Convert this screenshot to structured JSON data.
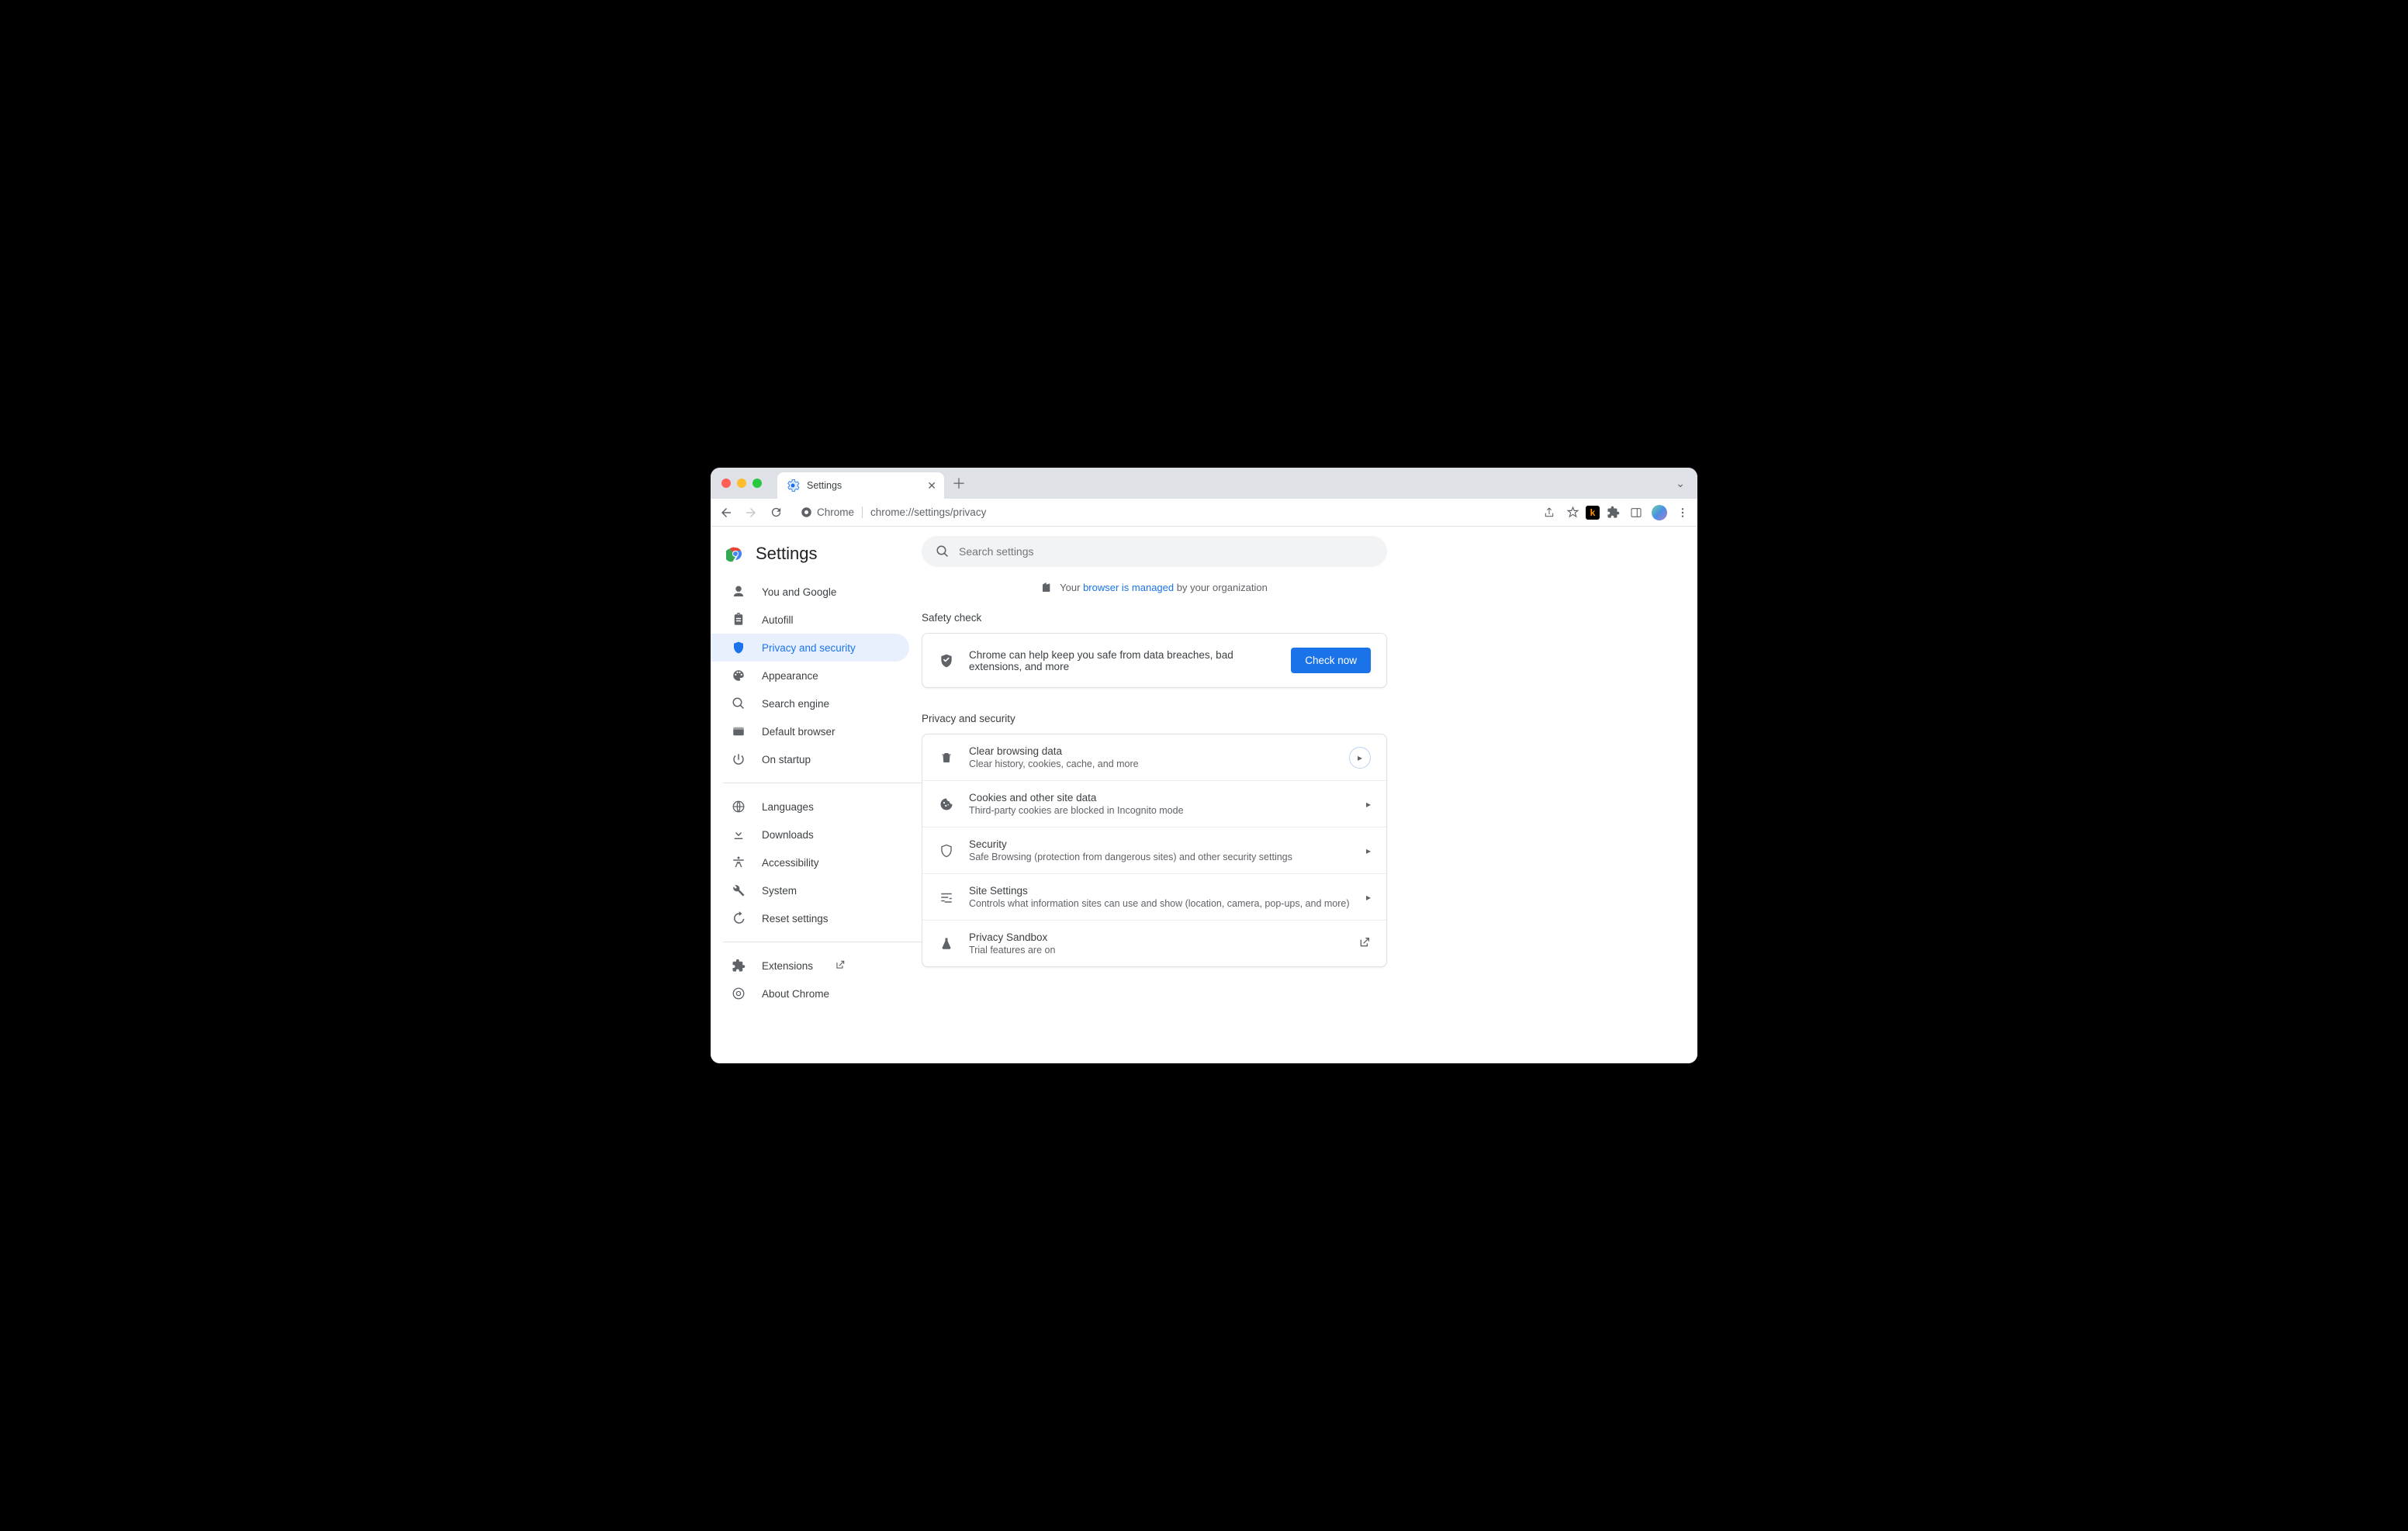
{
  "tab": {
    "title": "Settings"
  },
  "omnibox": {
    "chip": "Chrome",
    "url": "chrome://settings/privacy"
  },
  "page": {
    "title": "Settings",
    "search_placeholder": "Search settings",
    "managed_pre": "Your",
    "managed_link": "browser is managed",
    "managed_post": "by your organization"
  },
  "sidebar": {
    "primary": [
      {
        "label": "You and Google"
      },
      {
        "label": "Autofill"
      },
      {
        "label": "Privacy and security"
      },
      {
        "label": "Appearance"
      },
      {
        "label": "Search engine"
      },
      {
        "label": "Default browser"
      },
      {
        "label": "On startup"
      }
    ],
    "secondary": [
      {
        "label": "Languages"
      },
      {
        "label": "Downloads"
      },
      {
        "label": "Accessibility"
      },
      {
        "label": "System"
      },
      {
        "label": "Reset settings"
      }
    ],
    "footer": [
      {
        "label": "Extensions"
      },
      {
        "label": "About Chrome"
      }
    ]
  },
  "safety": {
    "heading": "Safety check",
    "text": "Chrome can help keep you safe from data breaches, bad extensions, and more",
    "button": "Check now"
  },
  "privacy": {
    "heading": "Privacy and security",
    "rows": [
      {
        "title": "Clear browsing data",
        "sub": "Clear history, cookies, cache, and more"
      },
      {
        "title": "Cookies and other site data",
        "sub": "Third-party cookies are blocked in Incognito mode"
      },
      {
        "title": "Security",
        "sub": "Safe Browsing (protection from dangerous sites) and other security settings"
      },
      {
        "title": "Site Settings",
        "sub": "Controls what information sites can use and show (location, camera, pop-ups, and more)"
      },
      {
        "title": "Privacy Sandbox",
        "sub": "Trial features are on"
      }
    ]
  }
}
